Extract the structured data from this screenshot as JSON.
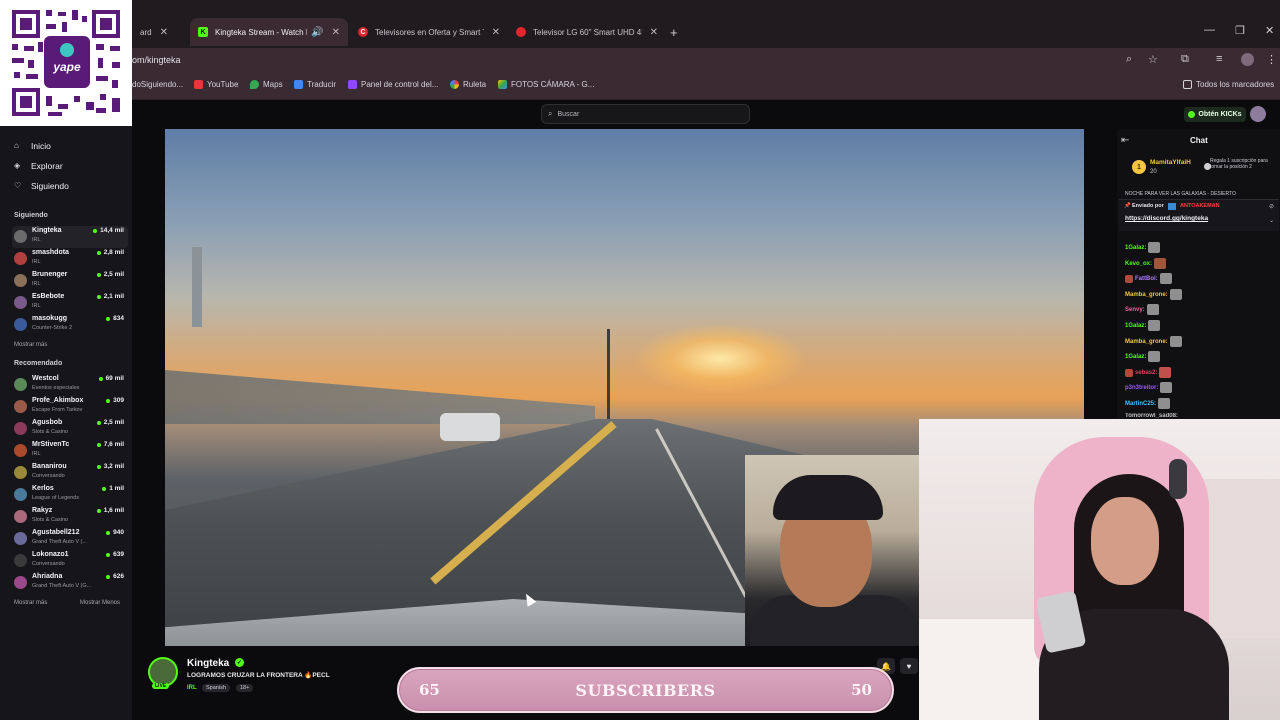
{
  "browser": {
    "tabs": [
      {
        "label": "ard",
        "active": false
      },
      {
        "label": "Kingteka Stream - Watch Li",
        "active": true
      },
      {
        "label": "Televisores en Oferta y Smart T",
        "active": false
      },
      {
        "label": "Televisor LG 60\" Smart UHD 4K",
        "active": false
      }
    ],
    "new_tab": "+",
    "url": "om/kingteka",
    "bookmarks": [
      "doSiguiendo...",
      "YouTube",
      "Maps",
      "Traducir",
      "Panel de control del...",
      "Ruleta",
      "FOTOS CÁMARA - G..."
    ],
    "all_bookmarks": "Todos los marcadores"
  },
  "qr": {
    "brand": "yape"
  },
  "topbar": {
    "search_placeholder": "Buscar",
    "kicks_label": "Obtén KICKs"
  },
  "sidebar": {
    "nav": [
      {
        "label": "Inicio",
        "icon": "home-icon"
      },
      {
        "label": "Explorar",
        "icon": "compass-icon"
      },
      {
        "label": "Siguiendo",
        "icon": "heart-icon"
      }
    ],
    "following_title": "Siguiendo",
    "following": [
      {
        "name": "Kingteka",
        "category": "IRL",
        "viewers": "14,4 mil",
        "color": "#6b6b6b"
      },
      {
        "name": "smashdota",
        "category": "IRL",
        "viewers": "2,8 mil",
        "color": "#b04040"
      },
      {
        "name": "Brunenger",
        "category": "IRL",
        "viewers": "2,5 mil",
        "color": "#8a6f5a"
      },
      {
        "name": "EsBebote",
        "category": "IRL",
        "viewers": "2,1 mil",
        "color": "#7a5a8a"
      },
      {
        "name": "masokugg",
        "category": "Counter-Strike 2",
        "viewers": "834",
        "color": "#3a5a9a"
      }
    ],
    "show_more": "Mostrar más",
    "recommended_title": "Recomendado",
    "recommended": [
      {
        "name": "Westcol",
        "category": "Eventos especiales",
        "viewers": "69 mil",
        "color": "#5a8a5a"
      },
      {
        "name": "Profe_Akimbox",
        "category": "Escape From Tarkov",
        "viewers": "309",
        "color": "#9a5a4a"
      },
      {
        "name": "Agusbob",
        "category": "Slots & Casino",
        "viewers": "2,5 mil",
        "color": "#8a3a5a"
      },
      {
        "name": "MrStivenTc",
        "category": "IRL",
        "viewers": "7,6 mil",
        "color": "#aa4a2a"
      },
      {
        "name": "Bananirou",
        "category": "Conversando",
        "viewers": "3,2 mil",
        "color": "#9a8a3a"
      },
      {
        "name": "Kerlos",
        "category": "League of Legends",
        "viewers": "1 mil",
        "color": "#4a7a9a"
      },
      {
        "name": "Rakyz",
        "category": "Slots & Casino",
        "viewers": "1,6 mil",
        "color": "#aa6a7a"
      },
      {
        "name": "Agustabell212",
        "category": "Grand Theft Auto V (...",
        "viewers": "940",
        "color": "#6a6a9a"
      },
      {
        "name": "Lokonazo1",
        "category": "Conversando",
        "viewers": "639",
        "color": "#3a3a3a"
      },
      {
        "name": "Ahriadna",
        "category": "Grand Theft Auto V (G...",
        "viewers": "626",
        "color": "#9a4a8a"
      }
    ],
    "show_more_2": "Mostrar más",
    "show_less": "Mostrar Menos"
  },
  "chat": {
    "title": "Chat",
    "gift": {
      "rank": "1",
      "user": "MamitaYlfaiH",
      "count": "20",
      "text": "Regala 1 suscripción para tomar la posición 2"
    },
    "pinned": {
      "header": "Enviado por",
      "sender": "ANTOAKEMAN",
      "link": "https://discord.gg/kingteka",
      "top_cut": "NOCHE PARA VER LAS GALAXIAS - DESIERTO"
    },
    "messages": [
      {
        "user": "1Galaz:",
        "color": "#53fc18"
      },
      {
        "user": "Kevo_ox:",
        "color": "#53fc18"
      },
      {
        "user": "FattBoi:",
        "color": "#b07cff"
      },
      {
        "user": "Mamba_grone:",
        "color": "#f5c542"
      },
      {
        "user": "Senvy:",
        "color": "#ff5ea0"
      },
      {
        "user": "1Galaz:",
        "color": "#53fc18"
      },
      {
        "user": "Mamba_grone:",
        "color": "#f5c542"
      },
      {
        "user": "1Galaz:",
        "color": "#53fc18"
      },
      {
        "user": "sebas2:",
        "color": "#e0405a"
      },
      {
        "user": "p3n3treitor:",
        "color": "#9b59ff"
      },
      {
        "user": "MartinC25:",
        "color": "#3ac1ff"
      },
      {
        "user": "Tomorrowl_sad08:",
        "color": "#c0c0c0"
      }
    ]
  },
  "stream": {
    "name": "Kingteka",
    "title": "LOGRAMOS CRUZAR LA FRONTERA 🔥PECL",
    "category": "IRL",
    "tags": [
      "Spanish",
      "18+"
    ],
    "live": "LIVE"
  },
  "subs_overlay": {
    "left": "65",
    "label": "SUBSCRIBERS",
    "right": "50"
  },
  "colors": {
    "kick_green": "#53fc18",
    "overlay_pink": "#d9a6be"
  }
}
